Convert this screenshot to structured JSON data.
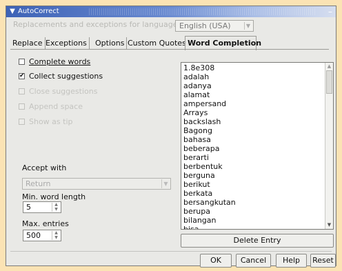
{
  "window": {
    "title": "AutoCorrect"
  },
  "language": {
    "label": "Replacements and exceptions for language:",
    "value": "English (USA)"
  },
  "tabs": [
    "Replace",
    "Exceptions",
    "Options",
    "Custom Quotes",
    "Word Completion"
  ],
  "active_tab": "Word Completion",
  "options": {
    "complete_words": {
      "label": "Complete words",
      "checked": false,
      "enabled": true
    },
    "collect_suggestions": {
      "label": "Collect suggestions",
      "checked": true,
      "enabled": true
    },
    "close_suggestions": {
      "label": "Close suggestions",
      "checked": false,
      "enabled": false
    },
    "append_space": {
      "label": "Append space",
      "checked": false,
      "enabled": false
    },
    "show_as_tip": {
      "label": "Show as tip",
      "checked": false,
      "enabled": false
    }
  },
  "accept_with": {
    "label": "Accept with",
    "value": "Return"
  },
  "min_word_length": {
    "label": "Min. word length",
    "value": "5"
  },
  "max_entries": {
    "label": "Max. entries",
    "value": "500"
  },
  "word_list": [
    "1.8e308",
    "adalah",
    "adanya",
    "alamat",
    "ampersand",
    "Arrays",
    "backslash",
    "Bagong",
    "bahasa",
    "beberapa",
    "berarti",
    "berbentuk",
    "berguna",
    "berikut",
    "berkata",
    "bersangkutan",
    "berupa",
    "bilangan",
    "bisa"
  ],
  "buttons": {
    "delete_entry": "Delete Entry",
    "ok": "OK",
    "cancel": "Cancel",
    "help": "Help",
    "reset": "Reset"
  }
}
